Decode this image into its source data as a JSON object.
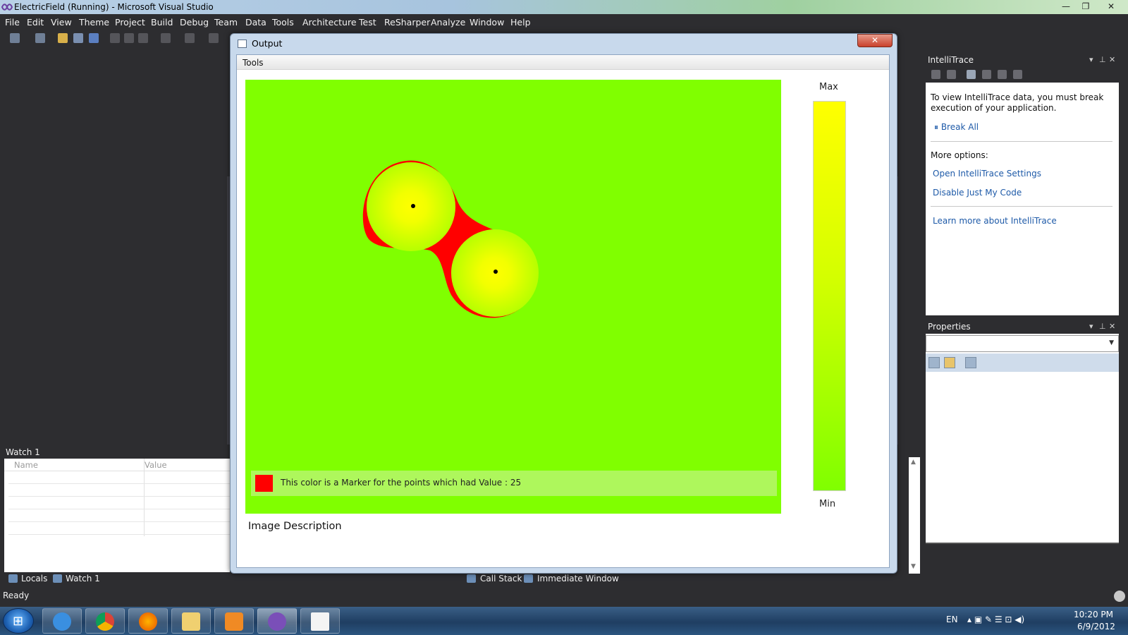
{
  "window": {
    "title": "ElectricField (Running) - Microsoft Visual Studio",
    "minimize": "—",
    "restore": "❐",
    "close": "✕"
  },
  "menu": [
    "File",
    "Edit",
    "View",
    "Theme",
    "Project",
    "Build",
    "Debug",
    "Team",
    "Data",
    "Tools",
    "Architecture",
    "Test",
    "ReSharper",
    "Analyze",
    "Window",
    "Help"
  ],
  "output_window": {
    "title": "Output",
    "close": "✕",
    "tools_menu": "Tools",
    "marker_text": "This color is a Marker for the points which had Value : 25",
    "marker_color": "#ff0000",
    "field_color": "#80ff00",
    "legend_max": "Max",
    "legend_min": "Min",
    "image_description": "Image Description"
  },
  "watch": {
    "title": "Watch 1",
    "col_name": "Name",
    "col_value": "Value"
  },
  "bottom_tabs": {
    "locals": "Locals",
    "watch1": "Watch 1",
    "call_stack": "Call Stack",
    "immediate": "Immediate Window"
  },
  "status": {
    "text": "Ready"
  },
  "intellitrace": {
    "title": "IntelliTrace",
    "info": "To view IntelliTrace data, you must break execution of your application.",
    "break_all": "Break All",
    "more_options": "More options:",
    "settings_link": "Open IntelliTrace Settings",
    "just_my_code_link": "Disable Just My Code",
    "learn_more_link": "Learn more about IntelliTrace"
  },
  "properties": {
    "title": "Properties"
  },
  "taskbar": {
    "language": "EN",
    "time": "10:20 PM",
    "date": "6/9/2012",
    "apps": [
      "ie-icon",
      "chrome-icon",
      "firefox-icon",
      "explorer-icon",
      "media-player-icon",
      "visual-studio-icon",
      "app-window-icon"
    ]
  }
}
